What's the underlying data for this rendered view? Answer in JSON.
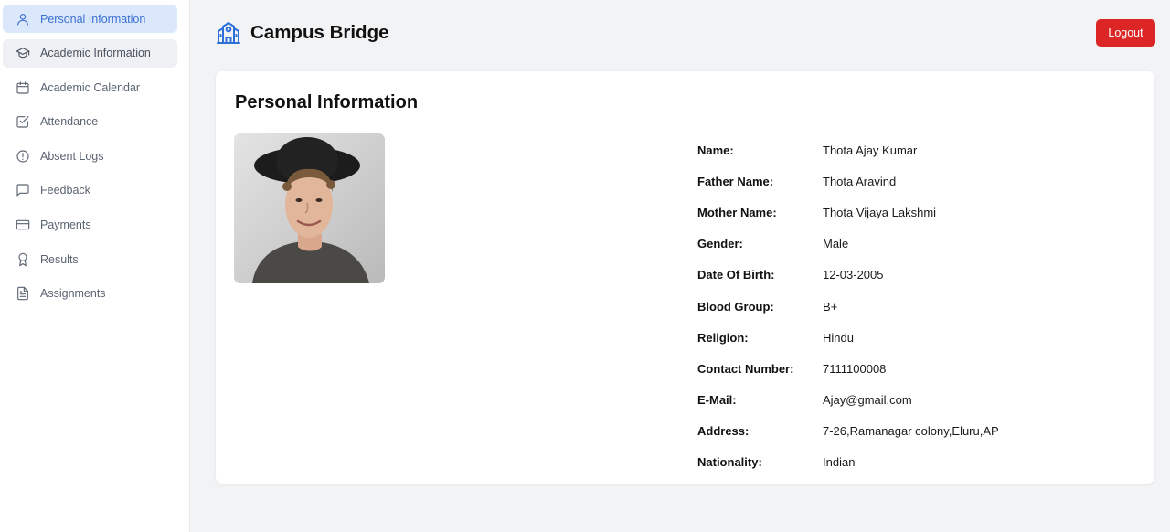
{
  "sidebar": {
    "items": [
      {
        "label": "Personal Information",
        "icon": "user-icon"
      },
      {
        "label": "Academic Information",
        "icon": "graduation-cap-icon"
      },
      {
        "label": "Academic Calendar",
        "icon": "calendar-icon"
      },
      {
        "label": "Attendance",
        "icon": "check-square-icon"
      },
      {
        "label": "Absent Logs",
        "icon": "alert-circle-icon"
      },
      {
        "label": "Feedback",
        "icon": "message-square-icon"
      },
      {
        "label": "Payments",
        "icon": "credit-card-icon"
      },
      {
        "label": "Results",
        "icon": "award-icon"
      },
      {
        "label": "Assignments",
        "icon": "file-text-icon"
      }
    ],
    "active_index": 0
  },
  "header": {
    "title": "Campus Bridge",
    "logout_label": "Logout",
    "brand_icon": "school-icon"
  },
  "colors": {
    "accent": "#2c6fd9",
    "active_bg": "#dbe8fb",
    "logout_bg": "#dc2626"
  },
  "main": {
    "title": "Personal Information",
    "fields": [
      {
        "label": "Name:",
        "value": "Thota Ajay Kumar"
      },
      {
        "label": "Father Name:",
        "value": "Thota Aravind"
      },
      {
        "label": "Mother Name:",
        "value": "Thota Vijaya Lakshmi"
      },
      {
        "label": "Gender:",
        "value": "Male"
      },
      {
        "label": "Date Of Birth:",
        "value": "12-03-2005"
      },
      {
        "label": "Blood Group:",
        "value": "B+"
      },
      {
        "label": "Religion:",
        "value": "Hindu"
      },
      {
        "label": "Contact Number:",
        "value": "7111100008"
      },
      {
        "label": "E-Mail:",
        "value": "Ajay@gmail.com"
      },
      {
        "label": "Address:",
        "value": "7-26,Ramanagar colony,Eluru,AP"
      },
      {
        "label": "Nationality:",
        "value": "Indian"
      }
    ]
  }
}
